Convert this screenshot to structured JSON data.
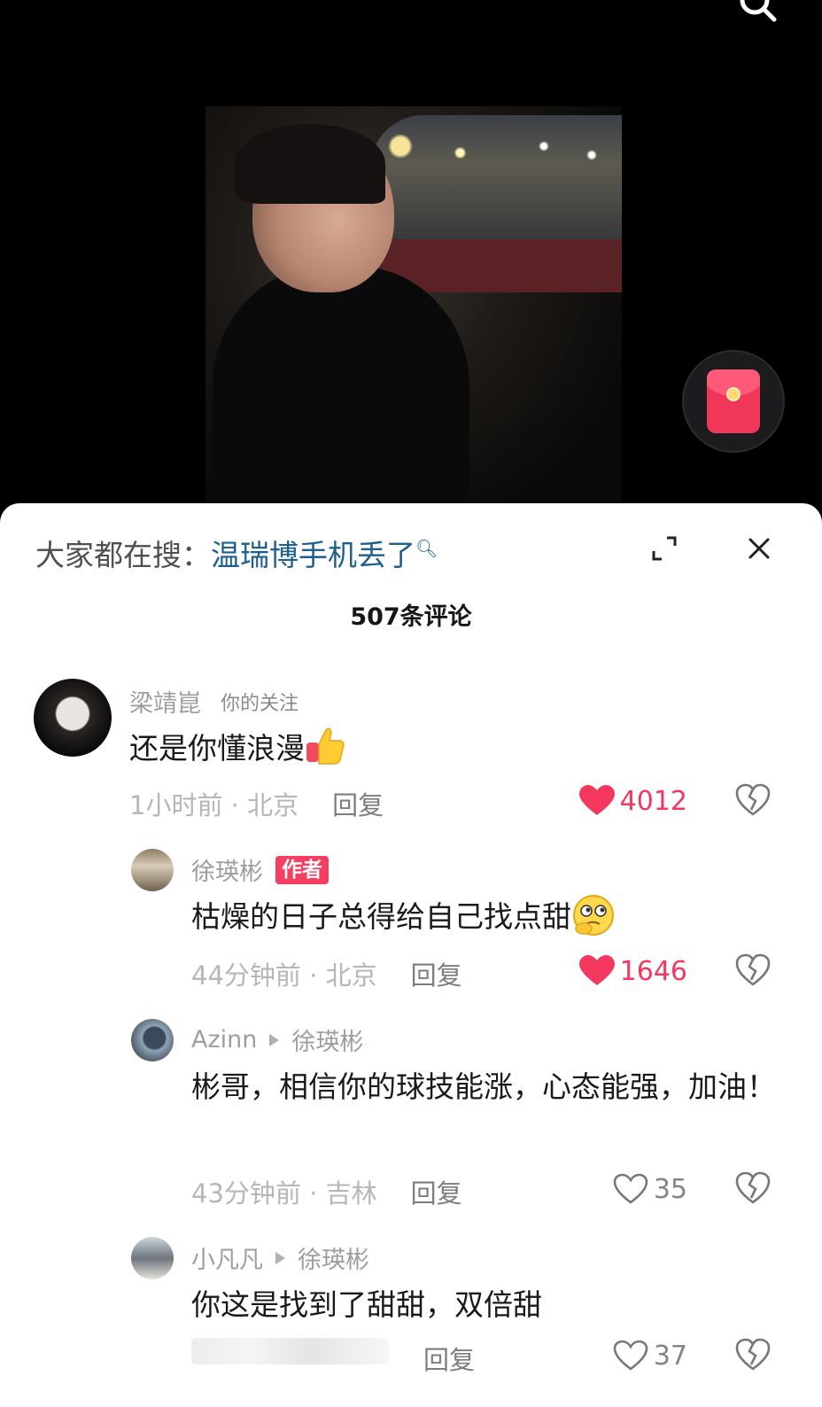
{
  "panel": {
    "search_prefix": "大家都在搜：",
    "search_query": "温瑞博手机丢了",
    "comment_count_title": "507条评论"
  },
  "comments": [
    {
      "username": "梁靖崑",
      "tag": "你的关注",
      "text": "还是你懂浪漫",
      "emoji": "thumbs-up",
      "time": "1小时前",
      "location": "北京",
      "reply_label": "回复",
      "likes": "4012",
      "liked": true
    },
    {
      "username": "徐瑛彬",
      "badge": "作者",
      "text": "枯燥的日子总得给自己找点甜",
      "emoji": "thinking-face",
      "time": "44分钟前",
      "location": "北京",
      "reply_label": "回复",
      "likes": "1646",
      "liked": true
    },
    {
      "username": "Azinn",
      "reply_to": "徐瑛彬",
      "text": "彬哥，相信你的球技能涨，心态能强，加油！",
      "time": "43分钟前",
      "location": "吉林",
      "reply_label": "回复",
      "likes": "35",
      "liked": false
    },
    {
      "username": "小凡凡",
      "reply_to": "徐瑛彬",
      "text": "你这是找到了甜甜，双倍甜",
      "reply_label": "回复",
      "likes": "37",
      "liked": false
    }
  ],
  "separator": " · ",
  "colors": {
    "liked_red": "#f4375f",
    "link_blue": "#1f5f8e",
    "author_badge": "#f43e62"
  }
}
